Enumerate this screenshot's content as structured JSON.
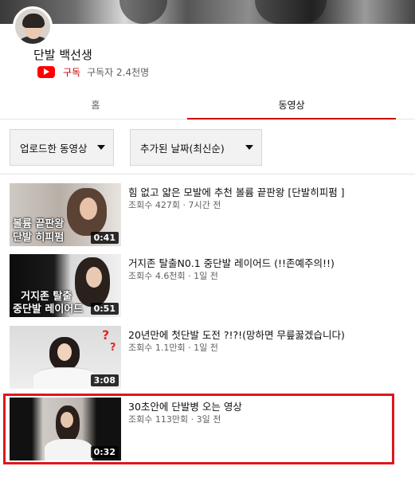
{
  "channel": {
    "name": "단발 백선생",
    "subscribe_label": "구독",
    "subscriber_count": "구독자 2.4천명"
  },
  "tabs": [
    {
      "label": "홈",
      "selected": false
    },
    {
      "label": "동영상",
      "selected": true
    }
  ],
  "filters": {
    "type_label": "업로드한 동영상",
    "sort_label": "추가된 날짜(최신순)"
  },
  "videos": [
    {
      "title": "힘 없고 얇은 모발에 추천 볼륨 끝판왕 [단발히피펌 ]",
      "meta": "조회수 427회 · 7시간 전",
      "duration": "0:41",
      "overlay": [
        "볼륨 끝판왕",
        "단발 히피펌"
      ]
    },
    {
      "title": "거지존 탈출N0.1 중단발 레이어드 (!!존예주의!!)",
      "meta": "조회수 4.6천회 · 1일 전",
      "duration": "0:51",
      "overlay": [
        "거지존 탈출",
        "중단발 레이어드"
      ]
    },
    {
      "title": "20년만에 첫단발 도전 ?!?!(망하면 무릎꿇겠습니다)",
      "meta": "조회수 1.1만회 · 1일 전",
      "duration": "3:08",
      "overlay": []
    },
    {
      "title": "30초안에 단발병 오는 영상",
      "meta": "조회수 113만회 · 3일 전",
      "duration": "0:32",
      "overlay": []
    }
  ],
  "colors": {
    "accent_red": "#cc0000",
    "highlight_red": "#e0161d"
  }
}
